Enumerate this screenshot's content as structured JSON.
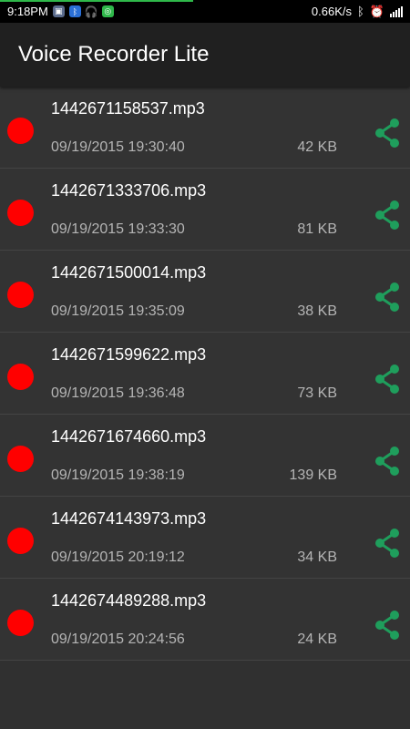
{
  "status_bar": {
    "time": "9:18PM",
    "speed": "0.66K/s",
    "icons": [
      "app-icon",
      "bluetooth-icon",
      "headphones-icon",
      "app-icon",
      "bluetooth-icon",
      "alarm-icon",
      "signal-icon"
    ]
  },
  "app": {
    "title": "Voice Recorder Lite"
  },
  "recordings": [
    {
      "name": "1442671158537.mp3",
      "date": "09/19/2015 19:30:40",
      "size": "42 KB"
    },
    {
      "name": "1442671333706.mp3",
      "date": "09/19/2015 19:33:30",
      "size": "81 KB"
    },
    {
      "name": "1442671500014.mp3",
      "date": "09/19/2015 19:35:09",
      "size": "38 KB"
    },
    {
      "name": "1442671599622.mp3",
      "date": "09/19/2015 19:36:48",
      "size": "73 KB"
    },
    {
      "name": "1442671674660.mp3",
      "date": "09/19/2015 19:38:19",
      "size": "139 KB"
    },
    {
      "name": "1442674143973.mp3",
      "date": "09/19/2015 20:19:12",
      "size": "34 KB"
    },
    {
      "name": "1442674489288.mp3",
      "date": "09/19/2015 20:24:56",
      "size": "24 KB"
    }
  ],
  "colors": {
    "record_dot": "#ff0000",
    "share_icon": "#1f9e5c"
  }
}
